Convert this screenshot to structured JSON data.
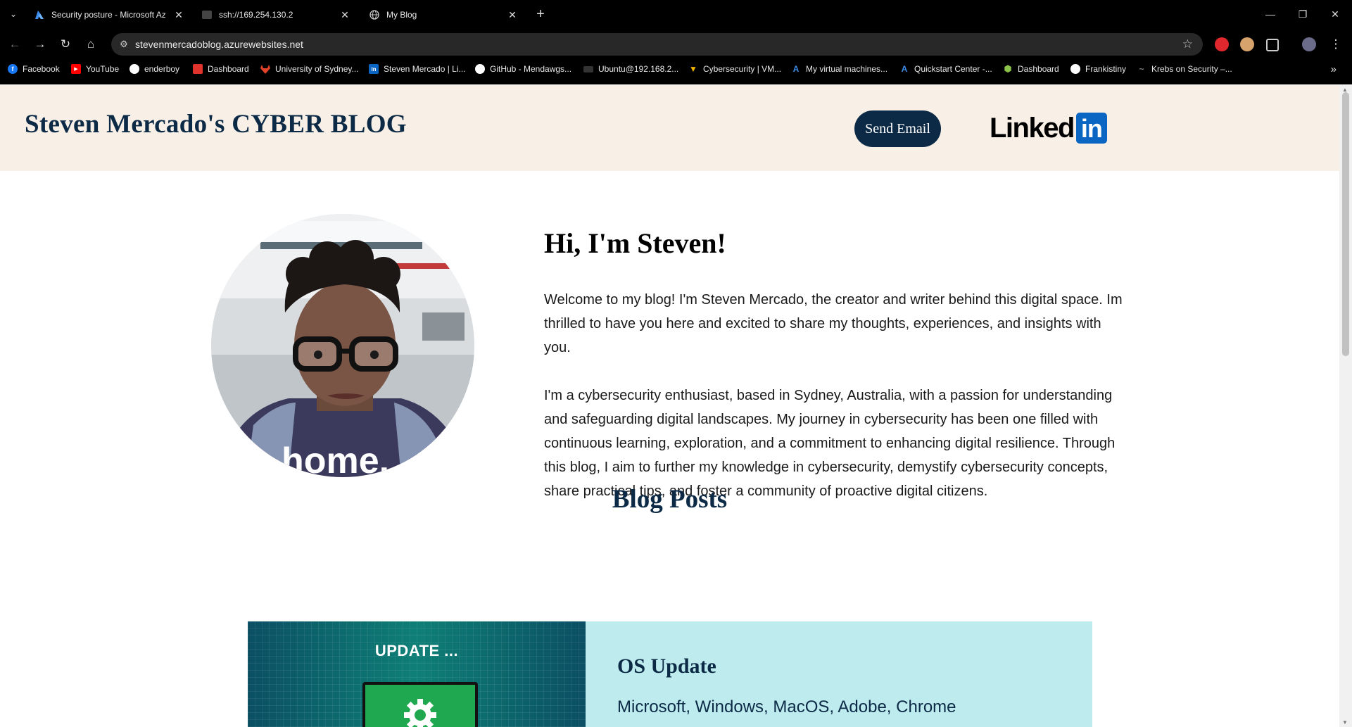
{
  "browser": {
    "tabs": [
      {
        "title": "Security posture - Microsoft Az",
        "icon": "azure-icon",
        "active": false
      },
      {
        "title": "ssh://169.254.130.2",
        "icon": "terminal-icon",
        "active": false
      },
      {
        "title": "My Blog",
        "icon": "globe-icon",
        "active": true
      }
    ],
    "url": "stevenmercadoblog.azurewebsites.net",
    "bookmarks": [
      {
        "label": "Facebook",
        "icon": "facebook-icon",
        "color": "#1877f2",
        "glyph": "f"
      },
      {
        "label": "YouTube",
        "icon": "youtube-icon",
        "color": "#ff0000",
        "glyph": "▶"
      },
      {
        "label": "enderboy",
        "icon": "profile-icon",
        "color": "#ffffff",
        "glyph": ""
      },
      {
        "label": "Dashboard",
        "icon": "dashboard-icon",
        "color": "#e0332b",
        "glyph": ""
      },
      {
        "label": "University of Sydney...",
        "icon": "gitlab-icon",
        "color": "#e24329",
        "glyph": ""
      },
      {
        "label": "Steven Mercado | Li...",
        "icon": "linkedin-icon",
        "color": "#0a66c2",
        "glyph": "in"
      },
      {
        "label": "GitHub - Mendawgs...",
        "icon": "github-icon",
        "color": "#ffffff",
        "glyph": ""
      },
      {
        "label": "Ubuntu@192.168.2...",
        "icon": "terminal-icon",
        "color": "#333333",
        "glyph": ""
      },
      {
        "label": "Cybersecurity | VM...",
        "icon": "vm-icon",
        "color": "#f0b400",
        "glyph": "▼"
      },
      {
        "label": "My virtual machines...",
        "icon": "azure-icon",
        "color": "#3b8eea",
        "glyph": "A"
      },
      {
        "label": "Quickstart Center -...",
        "icon": "azure-icon",
        "color": "#3b8eea",
        "glyph": "A"
      },
      {
        "label": "Dashboard",
        "icon": "cube-icon",
        "color": "#8bc34a",
        "glyph": "⬢"
      },
      {
        "label": "Frankistiny",
        "icon": "github-icon",
        "color": "#ffffff",
        "glyph": ""
      },
      {
        "label": "Krebs on Security –...",
        "icon": "krebs-icon",
        "color": "#555555",
        "glyph": "~"
      }
    ]
  },
  "site": {
    "title": "Steven Mercado's CYBER BLOG",
    "email_button": "Send Email",
    "linkedin_text": "Linked",
    "linkedin_box": "in"
  },
  "intro": {
    "heading": "Hi, I'm Steven!",
    "p1": "Welcome to my blog! I'm Steven Mercado, the creator and writer behind this digital space. Im thrilled to have you here and excited to share my thoughts, experiences, and insights with you.",
    "p2": "I'm a cybersecurity enthusiast, based in Sydney, Australia, with a passion for understanding and safeguarding digital landscapes. My journey in cybersecurity has been one filled with continuous learning, exploration, and a commitment to enhancing digital resilience. Through this blog, I aim to further my knowledge in cybersecurity, demystify cybersecurity concepts, share practical tips, and foster a community of proactive digital citizens.",
    "avatar_shirt_text": "home."
  },
  "posts": {
    "heading": "Blog Posts",
    "items": [
      {
        "image_text": "UPDATE ...",
        "title": "OS Update",
        "tags": "Microsoft, Windows, MacOS, Adobe, Chrome"
      }
    ]
  },
  "colors": {
    "navy": "#0c2a46",
    "header_bg": "#f8efe6",
    "card_bg": "#bdebee",
    "linkedin_blue": "#0a66c2"
  }
}
